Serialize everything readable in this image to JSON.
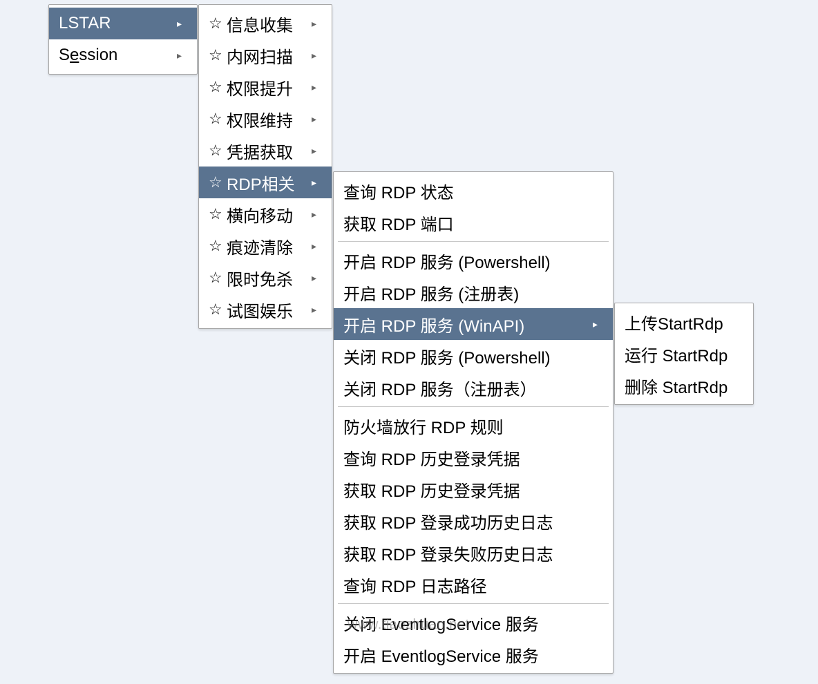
{
  "watermark": "www.tiaozhuan.net",
  "menu1": {
    "items": [
      {
        "label": "LSTAR",
        "selected": true,
        "arrow": true
      },
      {
        "label": "Session",
        "selected": false,
        "arrow": true,
        "underlineIndex": 1
      }
    ]
  },
  "menu2": {
    "items": [
      {
        "label": "信息收集",
        "selected": false
      },
      {
        "label": "内网扫描",
        "selected": false
      },
      {
        "label": "权限提升",
        "selected": false
      },
      {
        "label": "权限维持",
        "selected": false
      },
      {
        "label": "凭据获取",
        "selected": false
      },
      {
        "label": "RDP相关",
        "selected": true
      },
      {
        "label": "横向移动",
        "selected": false
      },
      {
        "label": "痕迹清除",
        "selected": false
      },
      {
        "label": "限时免杀",
        "selected": false
      },
      {
        "label": "试图娱乐",
        "selected": false
      }
    ]
  },
  "menu3": {
    "groups": [
      [
        {
          "label": "查询 RDP 状态"
        },
        {
          "label": "获取 RDP 端口"
        }
      ],
      [
        {
          "label": "开启 RDP 服务 (Powershell)"
        },
        {
          "label": "开启 RDP 服务 (注册表)"
        },
        {
          "label": "开启 RDP 服务 (WinAPI)",
          "selected": true,
          "arrow": true
        },
        {
          "label": "关闭 RDP 服务 (Powershell)"
        },
        {
          "label": "关闭 RDP 服务（注册表）"
        }
      ],
      [
        {
          "label": "防火墙放行 RDP 规则"
        },
        {
          "label": "查询 RDP 历史登录凭据"
        },
        {
          "label": "获取 RDP 历史登录凭据"
        },
        {
          "label": "获取 RDP 登录成功历史日志"
        },
        {
          "label": "获取 RDP 登录失败历史日志"
        },
        {
          "label": "查询 RDP 日志路径"
        }
      ],
      [
        {
          "label": "关闭 EventlogService 服务"
        },
        {
          "label": "开启 EventlogService 服务"
        }
      ]
    ]
  },
  "menu4": {
    "items": [
      {
        "label": "上传StartRdp"
      },
      {
        "label": "运行 StartRdp"
      },
      {
        "label": "删除 StartRdp"
      }
    ]
  }
}
